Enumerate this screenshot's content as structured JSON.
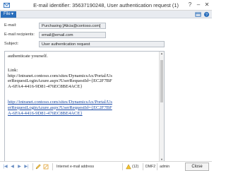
{
  "window": {
    "title": "E-mail identifier: 35637190248, User authentication request (1)",
    "help_glyph": "?",
    "minimize_glyph": "–",
    "close_glyph": "✕"
  },
  "ribbon": {
    "file_label": "File",
    "file_caret": "▼"
  },
  "form": {
    "email_label": "E-mail:",
    "email_value": "Purchasing [Alicia@contoso.com]",
    "recipients_label": "E-mail recipients:",
    "recipients_value": "email@email.com",
    "subject_label": "Subject:",
    "subject_value": "User authentication request"
  },
  "message": {
    "line_authenticate": "authenticate yourself.",
    "link_heading": "Link:",
    "plain_url": "http://intranet.contoso.com/sites/DynamicsAx/Portal/UserRequestLoginAzure.aspx?UserRequestId={EC2F7BFA-6FA4-4416-9D81-476EC8BE4ACE}",
    "hyperlink_url": "http://intranet.contoso.com/sites/DynamicsAx/Portal/UserRequestLoginAzure.aspx?UserRequestId={EC2F7BFA-6FA4-4416-9D81-476EC8BE4ACE}"
  },
  "statusbar": {
    "field_name": "Internet e-mail address",
    "count_badge": "(12)",
    "company": "DMF2",
    "user": "admin",
    "close_label": "Close"
  },
  "colors": {
    "accent": "#2a6ebb",
    "link": "#1a4aa6",
    "field_bg": "#eceef1"
  }
}
